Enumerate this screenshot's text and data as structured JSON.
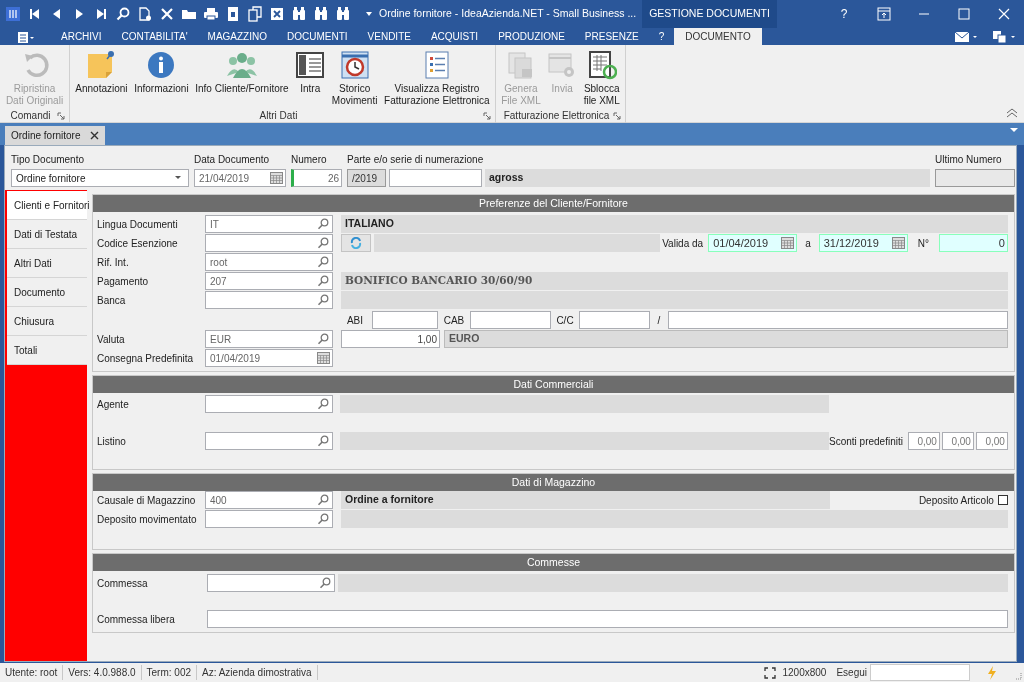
{
  "title_bar": {
    "title": "Ordine fornitore - IdeaAzienda.NET - Small Business ...",
    "context_tab": "GESTIONE DOCUMENTI",
    "help": "?"
  },
  "menu_tabs": [
    {
      "label": "ARCHIVI",
      "selected": false
    },
    {
      "label": "CONTABILITA'",
      "selected": false
    },
    {
      "label": "MAGAZZINO",
      "selected": false
    },
    {
      "label": "DOCUMENTI",
      "selected": false
    },
    {
      "label": "VENDITE",
      "selected": false
    },
    {
      "label": "ACQUISTI",
      "selected": false
    },
    {
      "label": "PRODUZIONE",
      "selected": false
    },
    {
      "label": "PRESENZE",
      "selected": false
    },
    {
      "label": "?",
      "selected": false
    },
    {
      "label": "DOCUMENTO",
      "selected": true
    }
  ],
  "ribbon_groups": [
    {
      "title": "Comandi",
      "buttons": [
        {
          "label": "Ripristina\nDati Originali",
          "disabled": true
        }
      ]
    },
    {
      "title": "Altri Dati",
      "buttons": [
        {
          "label": "Annotazioni",
          "disabled": false
        },
        {
          "label": "Informazioni",
          "disabled": false
        },
        {
          "label": "Info Cliente/Fornitore",
          "disabled": false
        },
        {
          "label": "Intra",
          "disabled": false
        },
        {
          "label": "Storico\nMovimenti",
          "disabled": false
        },
        {
          "label": "Visualizza Registro\nFatturazione Elettronica",
          "disabled": false
        }
      ]
    },
    {
      "title": "Fatturazione Elettronica",
      "buttons": [
        {
          "label": "Genera\nFile XML",
          "disabled": true
        },
        {
          "label": "Invia",
          "disabled": true
        },
        {
          "label": "Sblocca\nfile XML",
          "disabled": false
        }
      ]
    }
  ],
  "document_tab": {
    "label": "Ordine fornitore"
  },
  "header": {
    "tipo_documento": {
      "label": "Tipo Documento",
      "value": "Ordine fornitore"
    },
    "data_documento": {
      "label": "Data Documento",
      "value": "21/04/2019"
    },
    "numero": {
      "label": "Numero",
      "value": "26"
    },
    "numerazione": {
      "label": "Parte e/o serie di numerazione",
      "series": "/2019",
      "description": "agross"
    },
    "ultimo_numero": {
      "label": "Ultimo Numero"
    }
  },
  "nav_tabs": [
    {
      "label": "Clienti e Fornitori",
      "selected": true
    },
    {
      "label": "Dati di Testata",
      "selected": false
    },
    {
      "label": "Altri Dati",
      "selected": false
    },
    {
      "label": "Documento",
      "selected": false
    },
    {
      "label": "Chiusura",
      "selected": false
    },
    {
      "label": "Totali",
      "selected": false
    }
  ],
  "preferenze": {
    "title": "Preferenze del Cliente/Fornitore",
    "lingua": {
      "label": "Lingua Documenti",
      "value": "IT",
      "description": "ITALIANO"
    },
    "codice_esenzione": {
      "label": "Codice Esenzione"
    },
    "valida_da": {
      "label": "Valida da",
      "value": "01/04/2019"
    },
    "valida_a": {
      "label": "a",
      "value": "31/12/2019"
    },
    "numero": {
      "label": "N°",
      "value": "0"
    },
    "rif_int": {
      "label": "Rif. Int.",
      "value": "root"
    },
    "pagamento": {
      "label": "Pagamento",
      "value": "207",
      "description": "BONIFICO BANCARIO 30/60/90"
    },
    "banca": {
      "label": "Banca"
    },
    "abi": {
      "label": "ABI"
    },
    "cab": {
      "label": "CAB"
    },
    "cc": {
      "label": "C/C"
    },
    "cc_separator": "/",
    "valuta": {
      "label": "Valuta",
      "value": "EUR",
      "exchange": "1,00",
      "description": "EURO"
    },
    "consegna": {
      "label": "Consegna Predefinita",
      "value": "01/04/2019"
    }
  },
  "commerciali": {
    "title": "Dati Commerciali",
    "agente": {
      "label": "Agente"
    },
    "listino": {
      "label": "Listino"
    },
    "sconti": {
      "label": "Sconti predefiniti",
      "values": [
        "0,00",
        "0,00",
        "0,00"
      ]
    }
  },
  "magazzino": {
    "title": "Dati di Magazzino",
    "causale": {
      "label": "Causale di Magazzino",
      "value": "400",
      "description": "Ordine a fornitore"
    },
    "deposito": {
      "label": "Deposito movimentato"
    },
    "deposito_articolo": {
      "label": "Deposito Articolo",
      "checked": false
    }
  },
  "commesse": {
    "title": "Commesse",
    "commessa": {
      "label": "Commessa"
    },
    "commessa_libera": {
      "label": "Commessa libera"
    }
  },
  "status_bar": {
    "items": [
      "Utente: root",
      "Vers: 4.0.988.0",
      "Term: 002",
      "Az: Azienda dimostrativa"
    ],
    "resolution": "1200x800",
    "run_label": "Esegui"
  }
}
